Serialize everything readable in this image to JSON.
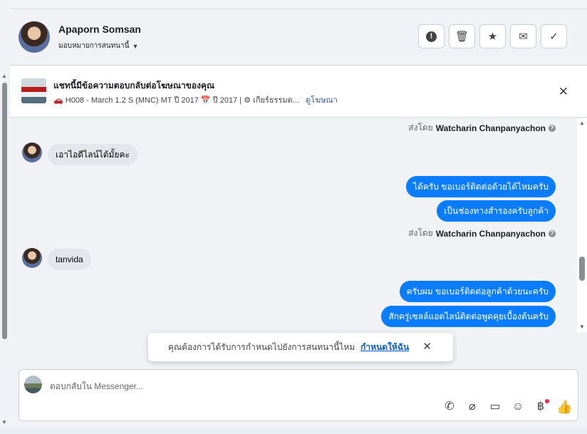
{
  "header": {
    "name": "Apaporn Somsan",
    "assign_label": "มอบหมายการสนทนานี้",
    "actions": [
      {
        "icon": "alert-icon",
        "glyph": "⚠"
      },
      {
        "icon": "trash-icon",
        "glyph": "🗑"
      },
      {
        "icon": "star-icon",
        "glyph": "★"
      },
      {
        "icon": "mail-icon",
        "glyph": "✉"
      },
      {
        "icon": "check-icon",
        "glyph": "✓"
      }
    ]
  },
  "ad_banner": {
    "title": "แชทนี้มีข้อความตอบกลับต่อโฆษณาของคุณ",
    "subtitle": "🚗 H008 - March 1.2 S (MNC) MT ปี 2017 📅 ปี 2017 | ⚙ เกียร์ธรรมด...",
    "link": "ดูโฆษณา"
  },
  "messages": {
    "sent_by_prefix": "ส่งโดย",
    "sender": "Watcharin Chanpanyachon",
    "in_1": "เอาไอดีไลน์ได้มั้ยคะ",
    "out_1": "ได้ครับ ขอเบอร์ติดต่อด้วยได้ไหมครับ",
    "out_2": "เป็นช่องทางสำรองครับลูกค้า",
    "in_2": "tanvida",
    "out_3": "ครับผม ขอเบอร์ติดต่อลูกค้าด้วยนะครับ",
    "out_4": "สักครู่เซลล์แอดไลน์ติดต่อพูดคุยเบื้องต้นครับ"
  },
  "toast": {
    "text": "คุณต้องการได้รับการกำหนดไปยังการสนทนานี้ไหม",
    "cta": "กำหนดให้ฉัน"
  },
  "composer": {
    "placeholder": "ตอบกลับใน Messenger...",
    "tools": [
      {
        "icon": "phone-icon",
        "glyph": "📞"
      },
      {
        "icon": "attachment-icon",
        "glyph": "📎"
      },
      {
        "icon": "saved-replies-icon",
        "glyph": "💬"
      },
      {
        "icon": "emoji-icon",
        "glyph": "☺"
      },
      {
        "icon": "baht-icon",
        "glyph": "฿"
      },
      {
        "icon": "like-icon",
        "glyph": "👍"
      }
    ]
  },
  "colors": {
    "outgoing_bubble": "#0a7cff",
    "incoming_bubble": "#e4e6eb",
    "link": "#385898"
  }
}
